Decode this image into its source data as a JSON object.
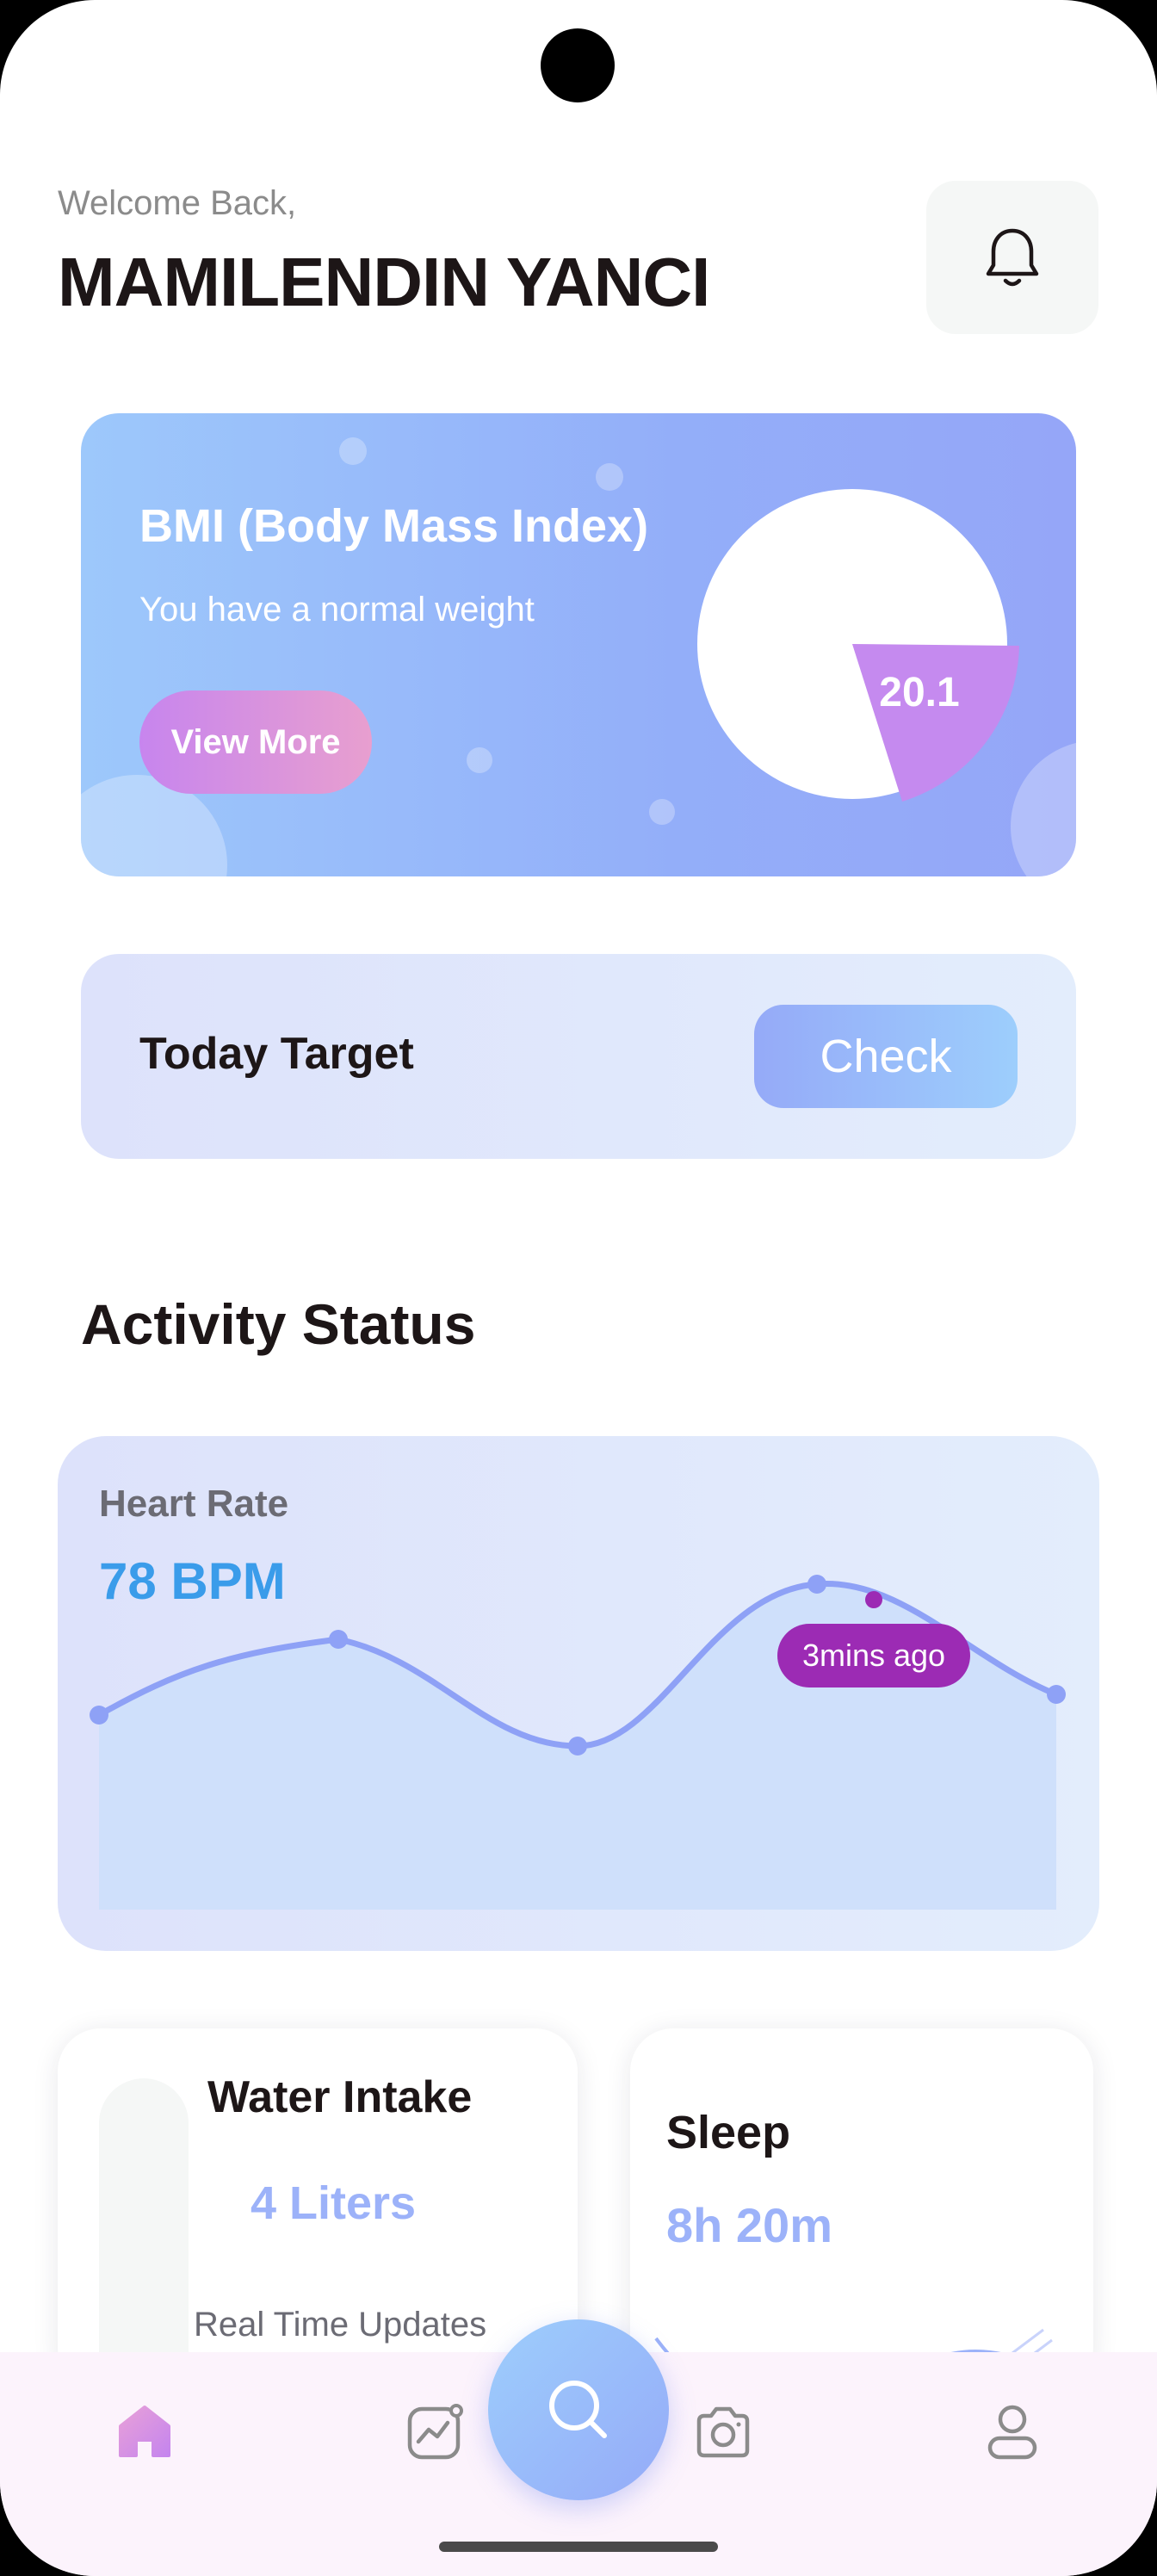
{
  "header": {
    "greeting": "Welcome Back,",
    "user_name": "MAMILENDIN YANCI",
    "notification_icon": "bell-icon"
  },
  "bmi_card": {
    "title": "BMI (Body Mass Index)",
    "subtitle": "You have a normal weight",
    "button_label": "View More",
    "bmi_value": "20.1"
  },
  "today_target": {
    "label": "Today Target",
    "button_label": "Check"
  },
  "activity": {
    "section_title": "Activity Status",
    "heart_rate": {
      "label": "Heart Rate",
      "value": "78 BPM",
      "tooltip": "3mins ago"
    },
    "water_intake": {
      "title": "Water Intake",
      "value": "4 Liters",
      "updates_label": "Real Time Updates",
      "fill_fraction": 0.1
    },
    "sleep": {
      "title": "Sleep",
      "value": "8h 20m"
    }
  },
  "bottom_nav": {
    "items": [
      {
        "icon": "home-icon",
        "active": true
      },
      {
        "icon": "activity-chart-icon",
        "active": false
      },
      {
        "icon": "search-icon",
        "active": false
      },
      {
        "icon": "camera-icon",
        "active": false
      },
      {
        "icon": "profile-icon",
        "active": false
      }
    ]
  },
  "colors": {
    "accent_blue": "#95aaf8",
    "accent_pink": "#c785ee",
    "heart_value": "#3a9cea",
    "tooltip": "#9c2bb4"
  }
}
